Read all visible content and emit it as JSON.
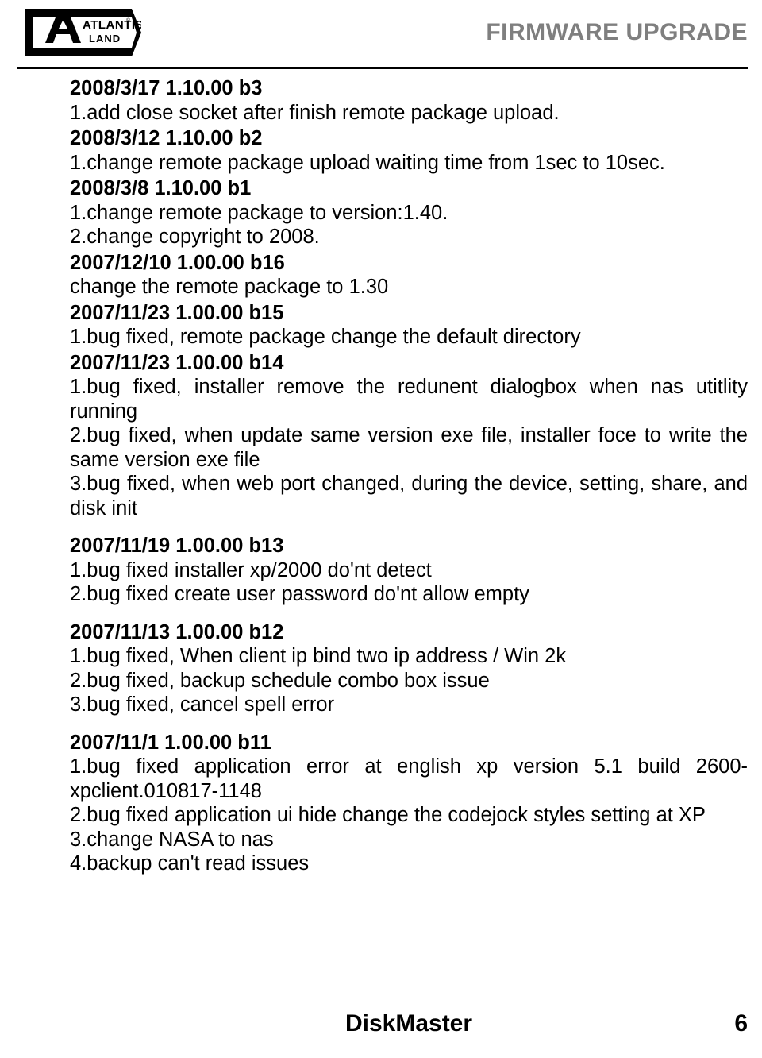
{
  "header": {
    "title": "FIRMWARE UPGRADE",
    "logo_alt": "atlantis-land-logo",
    "logo_text_top": "ATLANTIS",
    "logo_text_bottom": "LAND",
    "logo_registered": "®"
  },
  "entries": [
    {
      "version": "2008/3/17 1.10.00 b3",
      "lines": [
        "1.add close socket after finish remote package upload."
      ]
    },
    {
      "version": "2008/3/12 1.10.00 b2",
      "lines": [
        "1.change remote package upload waiting time from 1sec to 10sec."
      ]
    },
    {
      "version": "2008/3/8 1.10.00 b1",
      "lines": [
        "1.change remote package to version:1.40.",
        "2.change copyright to 2008."
      ]
    },
    {
      "version": "2007/12/10 1.00.00 b16",
      "lines": [
        "change the remote package to 1.30"
      ]
    },
    {
      "version": "2007/11/23 1.00.00 b15",
      "lines": [
        "1.bug fixed, remote package change  the default directory"
      ]
    },
    {
      "version": "2007/11/23 1.00.00 b14",
      "lines": [
        "1.bug fixed, installer remove the redunent dialogbox when nas utitlity running",
        "2.bug fixed, when update same version exe file, installer foce to write the same version  exe file",
        "3.bug fixed, when web port changed, during the device, setting, share, and disk init"
      ]
    },
    {
      "version": "2007/11/19 1.00.00 b13",
      "lines": [
        "1.bug fixed installer xp/2000 do'nt detect",
        "2.bug fixed create user password do'nt allow empty"
      ]
    },
    {
      "version": "2007/11/13 1.00.00 b12",
      "lines": [
        "1.bug fixed, When client ip bind two ip address /  Win 2k",
        "2.bug fixed, backup schedule combo box issue",
        "3.bug fixed, cancel spell error"
      ]
    },
    {
      "version": "2007/11/1 1.00.00 b11",
      "lines": [
        "1.bug fixed application error at english xp version 5.1 build 2600-xpclient.010817-1148",
        "2.bug fixed application ui hide change the codejock styles setting at XP",
        "3.change NASA to nas",
        "4.backup can't read issues"
      ]
    }
  ],
  "footer": {
    "product": "DiskMaster",
    "page_number": "6"
  }
}
